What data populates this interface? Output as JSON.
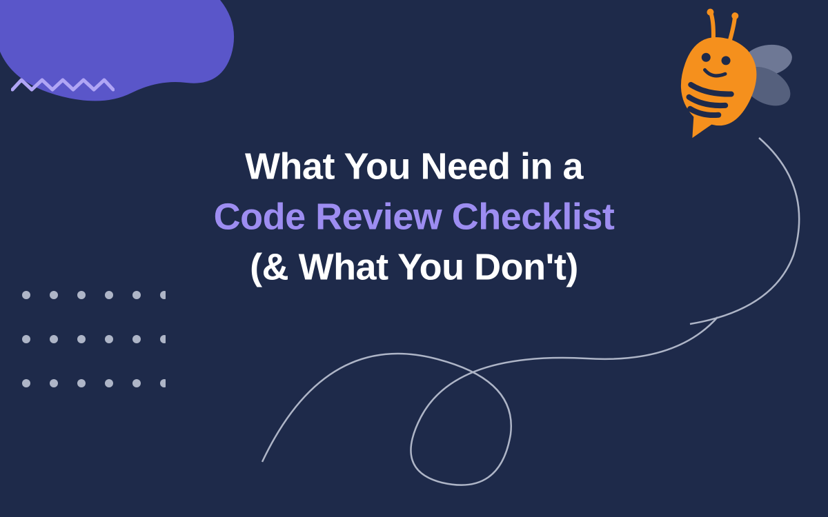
{
  "hero": {
    "line1": "What You Need in a",
    "line2": "Code Review Checklist",
    "line3": "(& What You Don't)"
  },
  "colors": {
    "background": "#1e2a4a",
    "accent": "#9d8df1",
    "blob": "#5a56c9",
    "zigzag": "#b0a5f5",
    "dots": "#aeb5c7",
    "bee_body": "#f5901d",
    "bee_wing": "#6e7895"
  }
}
